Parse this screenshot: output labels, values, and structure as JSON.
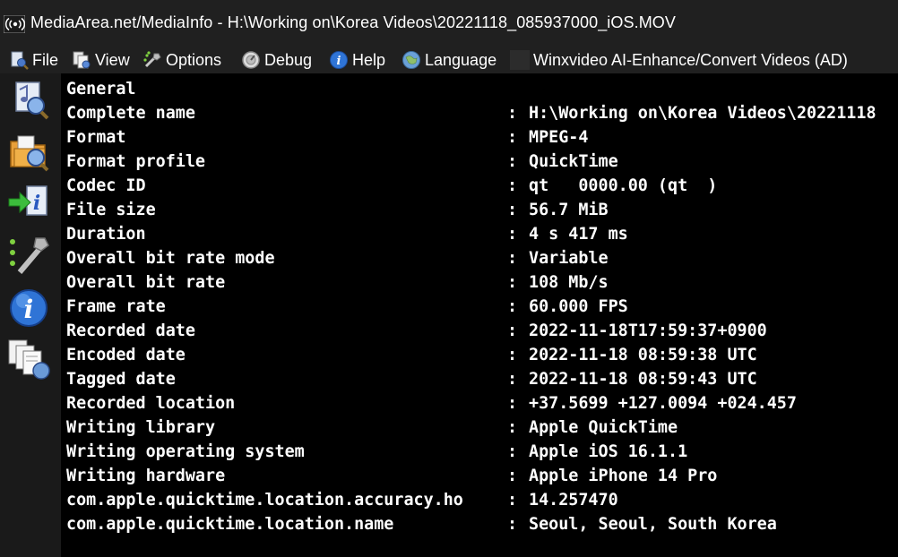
{
  "window": {
    "title": "MediaArea.net/MediaInfo - H:\\Working on\\Korea Videos\\20221118_085937000_iOS.MOV"
  },
  "menu": {
    "items": [
      {
        "label": "File",
        "icon": "file-icon"
      },
      {
        "label": "View",
        "icon": "view-icon"
      },
      {
        "label": "Options",
        "icon": "options-icon"
      },
      {
        "label": "Debug",
        "icon": "debug-icon"
      },
      {
        "label": "Help",
        "icon": "help-icon"
      },
      {
        "label": "Language",
        "icon": "language-icon"
      },
      {
        "label": "Winxvideo AI-Enhance/Convert Videos (AD)",
        "icon": "ad-icon"
      }
    ]
  },
  "toolbar": {
    "buttons": [
      {
        "icon": "open-file-icon"
      },
      {
        "icon": "open-folder-icon"
      },
      {
        "icon": "export-icon"
      },
      {
        "icon": "preferences-icon"
      },
      {
        "icon": "about-icon"
      },
      {
        "icon": "sheet-view-icon"
      }
    ]
  },
  "info": {
    "section": "General",
    "separator": ":",
    "rows": [
      {
        "key": "Complete name",
        "value": "H:\\Working on\\Korea Videos\\20221118"
      },
      {
        "key": "Format",
        "value": "MPEG-4"
      },
      {
        "key": "Format profile",
        "value": "QuickTime"
      },
      {
        "key": "Codec ID",
        "value": "qt   0000.00 (qt  )"
      },
      {
        "key": "File size",
        "value": "56.7 MiB"
      },
      {
        "key": "Duration",
        "value": "4 s 417 ms"
      },
      {
        "key": "Overall bit rate mode",
        "value": "Variable"
      },
      {
        "key": "Overall bit rate",
        "value": "108 Mb/s"
      },
      {
        "key": "Frame rate",
        "value": "60.000 FPS"
      },
      {
        "key": "Recorded date",
        "value": "2022-11-18T17:59:37+0900"
      },
      {
        "key": "Encoded date",
        "value": "2022-11-18 08:59:38 UTC"
      },
      {
        "key": "Tagged date",
        "value": "2022-11-18 08:59:43 UTC"
      },
      {
        "key": "Recorded location",
        "value": "+37.5699 +127.0094 +024.457"
      },
      {
        "key": "Writing library",
        "value": "Apple QuickTime"
      },
      {
        "key": "Writing operating system",
        "value": "Apple iOS 16.1.1"
      },
      {
        "key": "Writing hardware",
        "value": "Apple iPhone 14 Pro"
      },
      {
        "key": "com.apple.quicktime.location.accuracy.ho",
        "value": "14.257470"
      },
      {
        "key": "com.apple.quicktime.location.name",
        "value": "Seoul, Seoul, South Korea"
      }
    ]
  }
}
